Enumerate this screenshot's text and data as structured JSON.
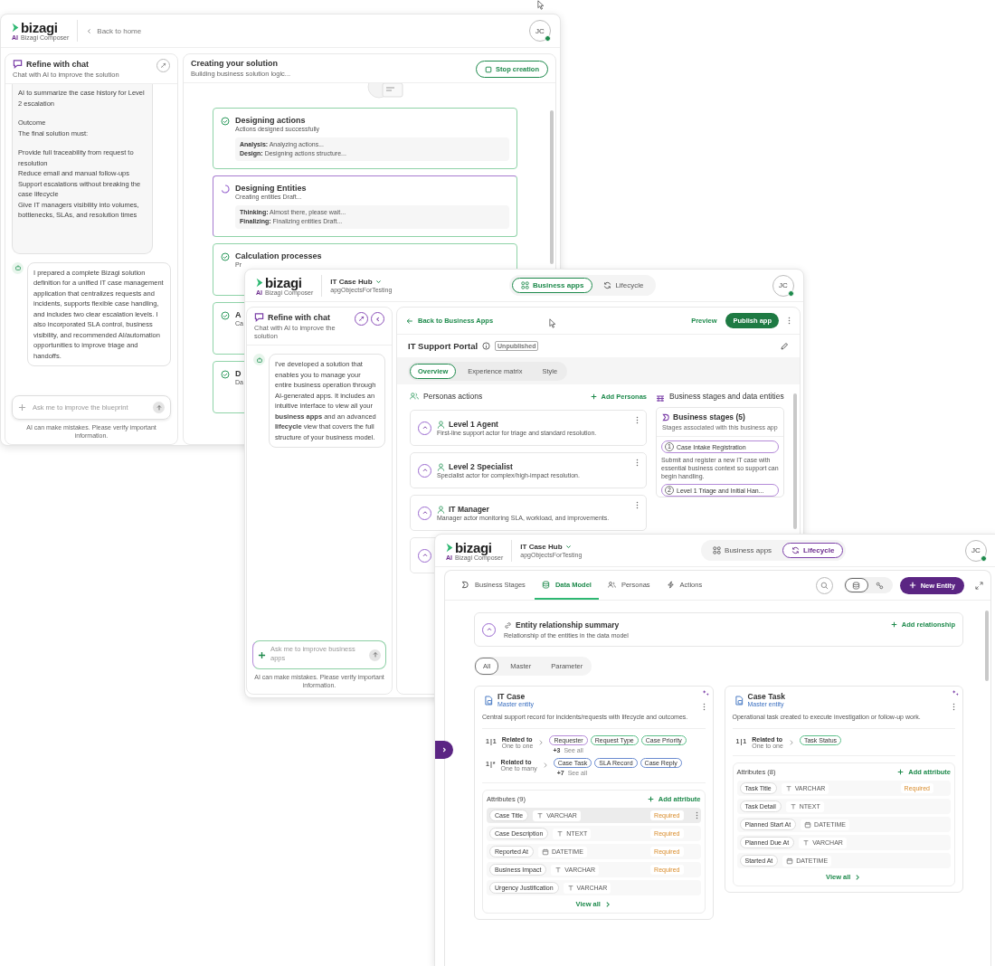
{
  "window_1": {
    "header": {
      "logo": {
        "brand": "bizagi",
        "ai": "AI",
        "product": "Bizagi Composer"
      },
      "back_link": "Back to home",
      "avatar": {
        "initials": "JC",
        "online": true
      }
    },
    "chat": {
      "title": "Refine with chat",
      "subtitle": "Chat with AI to improve the solution",
      "user_message": [
        "AI to summarize the case history for Level 2 escalation",
        "Outcome",
        "The final solution must:",
        "Provide full traceability from request to resolution",
        "Reduce email and manual follow-ups",
        "Support escalations without breaking the case lifecycle",
        "Give IT managers visibility into volumes, bottlenecks, SLAs, and resolution times"
      ],
      "assistant_message": "I prepared a complete Bizagi solution definition for a unified IT case management application that centralizes requests and incidents, supports flexible case handling, and includes two clear escalation levels. I also incorporated SLA control, business visibility, and recommended AI/automation opportunities to improve triage and handoffs.",
      "input": {
        "placeholder": "Ask me to improve the blueprint"
      },
      "disclaimer": "AI can make mistakes. Please verify important information."
    },
    "progress": {
      "title": "Creating your solution",
      "subtitle": "Building business solution logic...",
      "stop_button": "Stop creation",
      "steps": [
        {
          "title": "Designing actions",
          "subtitle": "Actions designed successfully",
          "done": true,
          "details": [
            {
              "label": "Analysis:",
              "text": "Analyzing actions..."
            },
            {
              "label": "Design:",
              "text": "Designing actions structure..."
            }
          ]
        },
        {
          "title": "Designing Entities",
          "subtitle": "Creating entities Draft...",
          "done": false,
          "details": [
            {
              "label": "Thinking:",
              "text": "Almost there, please wait..."
            },
            {
              "label": "Finalizing:",
              "text": "Finalizing entities Draft..."
            }
          ]
        },
        {
          "title": "Calculation processes",
          "subtitle": "Pr",
          "done": true
        },
        {
          "title": "A",
          "subtitle": "Ca",
          "done": true
        },
        {
          "title": "D",
          "subtitle": "Da",
          "done": true
        }
      ]
    }
  },
  "window_2": {
    "header": {
      "logo": {
        "brand": "bizagi",
        "ai": "AI",
        "product": "Bizagi Composer"
      },
      "project": "IT Case Hub",
      "workspace": "apgObjectsForTesting",
      "views": [
        {
          "label": "Business apps",
          "selected": true
        },
        {
          "label": "Lifecycle",
          "selected": false
        }
      ],
      "avatar": {
        "initials": "JC",
        "online": true
      }
    },
    "chat": {
      "title": "Refine with chat",
      "subtitle": "Chat with AI to improve the solution",
      "assistant_message": "I've developed a solution that enables you to manage your entire business operation through AI-generated apps. It includes an intuitive interface to view all your **business apps** and an advanced **lifecycle** view that covers the full structure of your business model.",
      "input": {
        "placeholder": "Ask me to improve business apps"
      },
      "disclaimer": "AI can make mistakes. Please verify important information."
    },
    "app": {
      "back_link": "Back to Business Apps",
      "preview": "Preview",
      "publish": "Publish app",
      "title": "IT Support Portal",
      "status": "Unpublished",
      "tabs": [
        {
          "label": "Overview",
          "selected": true
        },
        {
          "label": "Experience matrix",
          "selected": false
        },
        {
          "label": "Style",
          "selected": false
        }
      ],
      "personas": {
        "title": "Personas actions",
        "add": "Add Personas",
        "items": [
          {
            "kind": "card",
            "name": "Level 1 Agent",
            "description": "First-line support actor for triage and standard resolution."
          },
          {
            "kind": "card",
            "name": "Level 2 Specialist",
            "description": "Specialist actor for complex/high-impact resolution."
          },
          {
            "kind": "card",
            "name": "IT Manager",
            "description": "Manager actor monitoring SLA, workload, and improvements."
          },
          {
            "kind": "covered"
          }
        ]
      },
      "stages": {
        "section_title": "Business stages and data entities",
        "title": "Business stages (5)",
        "subtitle": "Stages associated with this business app",
        "items": [
          {
            "number": "1",
            "name": "Case Intake Registration",
            "description": "Submit and register a new IT case with essential business context so support can begin handling."
          },
          {
            "number": "2",
            "name": "Level 1 Triage and Initial Han..."
          }
        ]
      }
    }
  },
  "window_3": {
    "header": {
      "logo": {
        "brand": "bizagi",
        "ai": "AI",
        "product": "Bizagi Composer"
      },
      "project": "IT Case Hub",
      "workspace": "apgObjectsForTesting",
      "views": [
        {
          "label": "Business apps",
          "selected": false
        },
        {
          "label": "Lifecycle",
          "selected": true
        }
      ],
      "avatar": {
        "initials": "JC",
        "online": true
      }
    },
    "tabs": [
      {
        "label": "Business Stages",
        "selected": false
      },
      {
        "label": "Data Model",
        "selected": true
      },
      {
        "label": "Personas",
        "selected": false
      },
      {
        "label": "Actions",
        "selected": false
      }
    ],
    "view_toggle": [
      {
        "selected": true
      },
      {
        "selected": false
      }
    ],
    "new_entity": "New Entity",
    "summary": {
      "title": "Entity relationship summary",
      "subtitle": "Relationship of the entities in the data model",
      "add": "Add relationship"
    },
    "filters": [
      {
        "label": "All",
        "selected": true
      },
      {
        "label": "Master",
        "selected": false
      },
      {
        "label": "Parameter",
        "selected": false
      }
    ],
    "entities": [
      {
        "name": "IT Case",
        "type": "Master entity",
        "description": "Central support record for incidents/requests with lifecycle and outcomes.",
        "relations": [
          {
            "cardinality": "1|1",
            "label": "Related to",
            "type": "One to one",
            "tags": [
              {
                "label": "Requester",
                "color": "#b48ad8"
              },
              {
                "label": "Request Type",
                "color": "#5cc08a"
              },
              {
                "label": "Case Priority",
                "color": "#5cc08a"
              }
            ],
            "more": "+3",
            "see_all": "See all"
          },
          {
            "cardinality": "1|*",
            "label": "Related to",
            "type": "One to many",
            "tags": [
              {
                "label": "Case Task",
                "color": "#6a8bd0"
              },
              {
                "label": "SLA Record",
                "color": "#6a8bd0"
              },
              {
                "label": "Case Reply",
                "color": "#6a8bd0"
              }
            ],
            "more": "+7",
            "see_all": "See all"
          }
        ],
        "attributes_title": "Attributes (9)",
        "add_attribute": "Add attribute",
        "attributes": [
          {
            "name": "Case Title",
            "kind": "text",
            "type": "VARCHAR",
            "badge": "Required",
            "hovered": true
          },
          {
            "name": "Case Description",
            "kind": "text",
            "type": "NTEXT",
            "badge": "Required",
            "hovered": false
          },
          {
            "name": "Reported At",
            "kind": "date",
            "type": "DATETIME",
            "badge": "Required",
            "hovered": false
          },
          {
            "name": "Business Impact",
            "kind": "text",
            "type": "VARCHAR",
            "badge": "Required",
            "hovered": false
          },
          {
            "name": "Urgency Justification",
            "kind": "text",
            "type": "VARCHAR",
            "hovered": false
          }
        ],
        "view_all": "View all"
      },
      {
        "name": "Case Task",
        "type": "Master entity",
        "description": "Operational task created to execute investigation or follow-up work.",
        "relations": [
          {
            "cardinality": "1|1",
            "label": "Related to",
            "type": "One to one",
            "tags": [
              {
                "label": "Task Status",
                "color": "#5cc08a"
              }
            ]
          }
        ],
        "attributes_title": "Attributes (8)",
        "add_attribute": "Add attribute",
        "attributes": [
          {
            "name": "Task Title",
            "kind": "text",
            "type": "VARCHAR",
            "badge": "Required",
            "hovered": false
          },
          {
            "name": "Task Detail",
            "kind": "text",
            "type": "NTEXT",
            "hovered": false
          },
          {
            "name": "Planned Start At",
            "kind": "date",
            "type": "DATETIME",
            "hovered": false
          },
          {
            "name": "Planned Due At",
            "kind": "text",
            "type": "VARCHAR",
            "hovered": false
          },
          {
            "name": "Started At",
            "kind": "date",
            "type": "DATETIME",
            "hovered": false
          }
        ],
        "view_all": "View all"
      }
    ]
  }
}
